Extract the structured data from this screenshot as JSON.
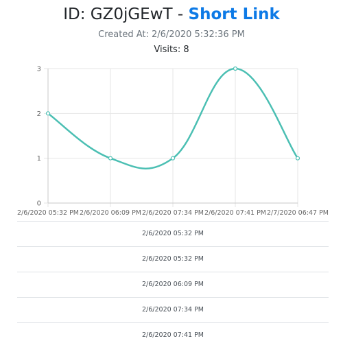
{
  "header": {
    "id_label": "ID: GZ0jGEwT -",
    "link_label": "Short Link",
    "created_at": "Created At: 2/6/2020 5:32:36 PM",
    "visits": "Visits: 8"
  },
  "visit_times": [
    "2/6/2020 05:32 PM",
    "2/6/2020 05:32 PM",
    "2/6/2020 06:09 PM",
    "2/6/2020 07:34 PM",
    "2/6/2020 07:41 PM"
  ],
  "colors": {
    "line": "#4bbfb3",
    "link": "#0d7ae6",
    "grid": "#e6e6e6",
    "axis_text": "#666666"
  },
  "chart_data": {
    "type": "line",
    "categories": [
      "2/6/2020 05:32 PM",
      "2/6/2020 06:09 PM",
      "2/6/2020 07:34 PM",
      "2/6/2020 07:41 PM",
      "2/7/2020 06:47 PM"
    ],
    "series": [
      {
        "values": [
          2,
          1,
          1,
          3,
          1
        ]
      }
    ],
    "y_ticks": [
      "0",
      "1",
      "2",
      "3"
    ],
    "ylim": [
      0,
      3
    ],
    "grid": true,
    "smooth": true
  }
}
